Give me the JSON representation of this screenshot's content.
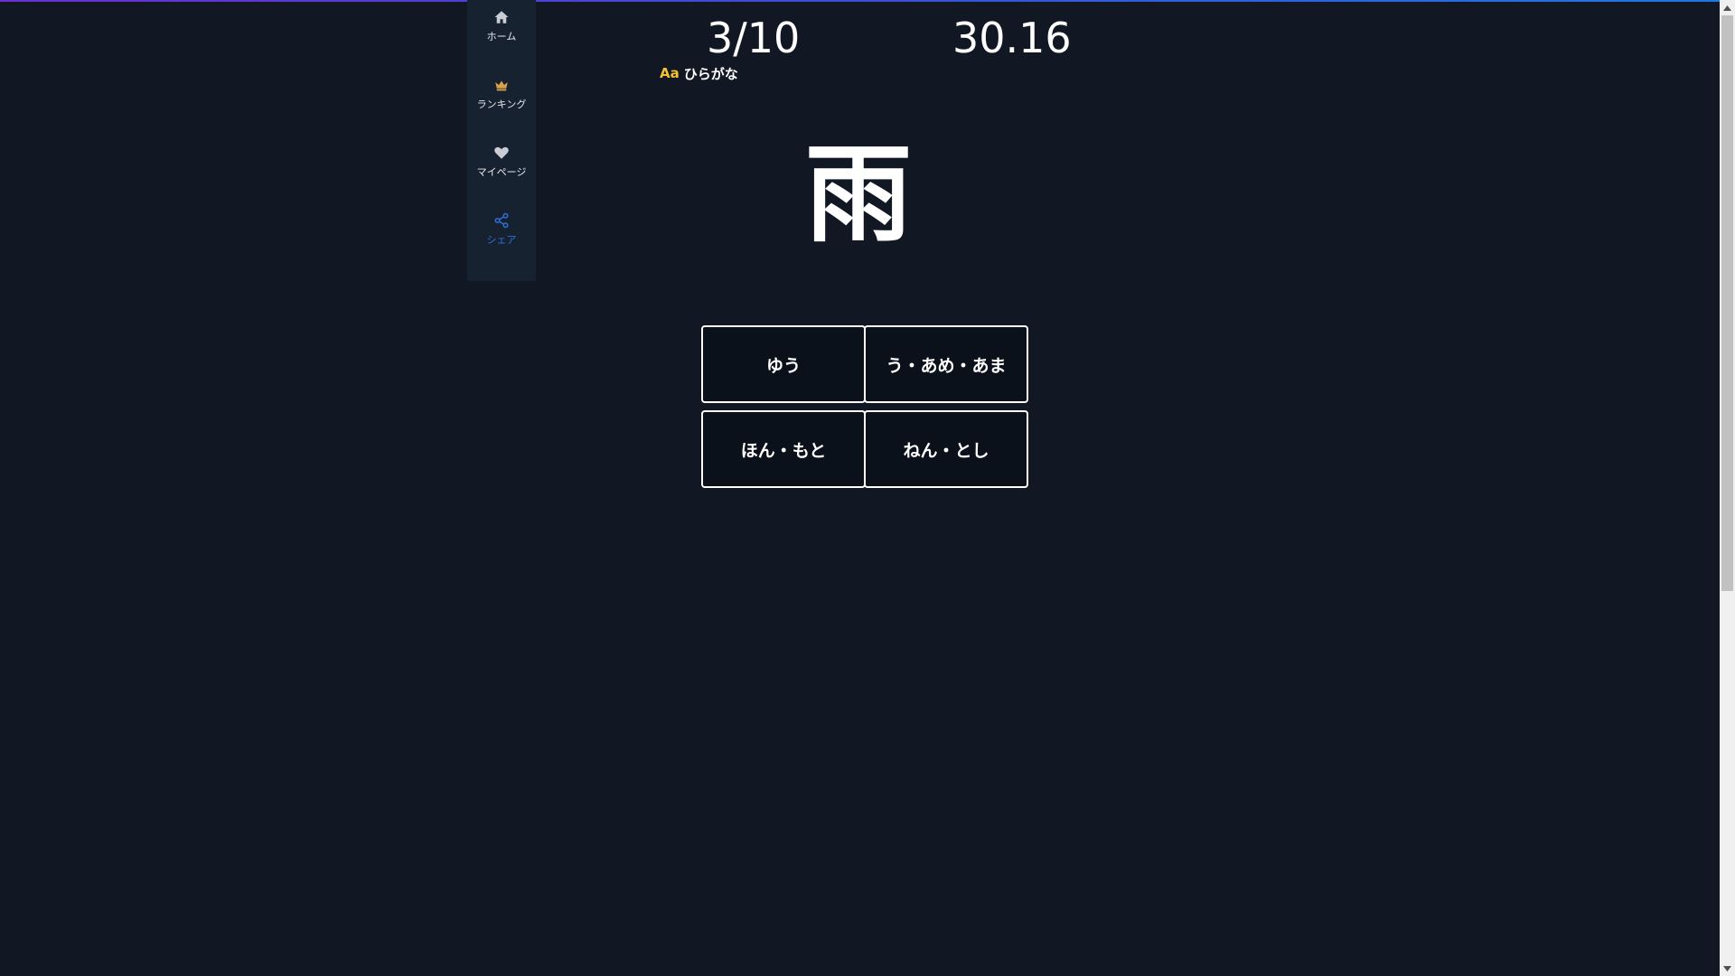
{
  "sidebar": {
    "items": [
      {
        "label": "ホーム",
        "icon": "home-icon"
      },
      {
        "label": "ランキング",
        "icon": "crown-icon"
      },
      {
        "label": "マイページ",
        "icon": "heart-icon"
      },
      {
        "label": "シェア",
        "icon": "share-icon"
      }
    ]
  },
  "quiz": {
    "progress": "3/10",
    "timer": "30.16",
    "mode_icon": "Aa",
    "mode_label": "ひらがな",
    "kanji": "雨",
    "choices": [
      "ゆう",
      "う・あめ・あま",
      "ほん・もと",
      "ねん・とし"
    ]
  },
  "colors": {
    "background": "#111824",
    "sidebar": "#172231",
    "accent_gold": "#f2c230",
    "share_blue": "#2f6fd6",
    "choice_bg": "#0b111b"
  }
}
